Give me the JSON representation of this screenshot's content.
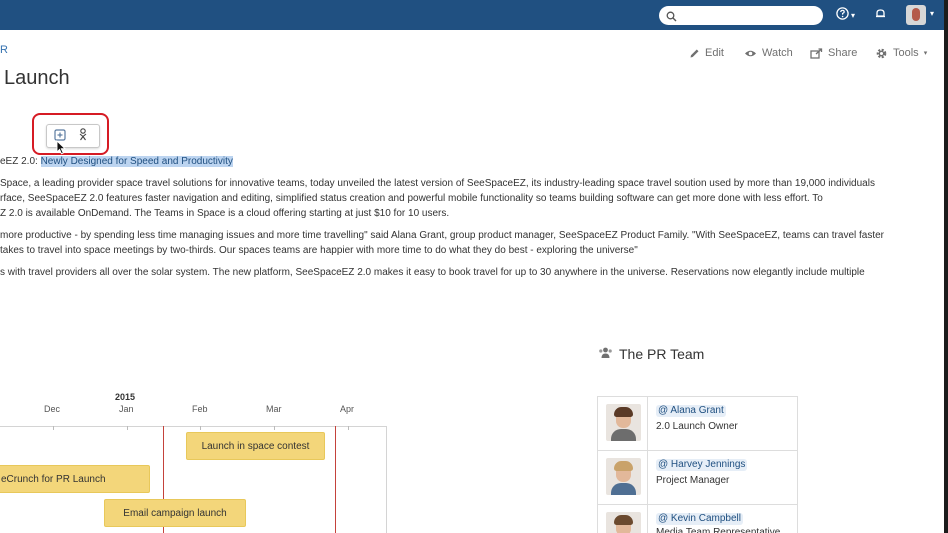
{
  "topbar": {
    "search_placeholder": "",
    "help_caret": "▾",
    "avatar_caret": "▾"
  },
  "breadcrumb": {
    "text": "R"
  },
  "page_actions": {
    "edit": "Edit",
    "watch": "Watch",
    "share": "Share",
    "tools": "Tools"
  },
  "page": {
    "title": "Launch"
  },
  "content": {
    "line1_prefix": "eEZ 2.0: ",
    "line1_highlight": "Newly Designed for Speed and Productivity",
    "para1": [
      "Space, a leading provider space travel solutions for innovative teams, today unveiled the latest version of SeeSpaceEZ, its industry-leading space travel soution used by more than 19,000 individuals",
      "rface, SeeSpaceEZ 2.0 features faster navigation and editing, simplified status creation and powerful mobile functionality so teams building software can get more done with less effort. To",
      "Z 2.0 is available OnDemand. The Teams in Space is a cloud offering starting at just $10 for 10 users."
    ],
    "para2": [
      "more productive - by spending less time managing issues and more time travelling\" said Alana Grant, group product manager, SeeSpaceEZ Product Family. \"With SeeSpaceEZ, teams can travel faster",
      "takes to travel into space meetings by two-thirds. Our spaces teams are happier with more time to do what they do best - exploring the universe\""
    ],
    "para3": [
      "s with travel providers all over the solar system.  The new platform, SeeSpaceEZ 2.0 makes it easy to book travel for up to 30 anywhere in the universe.  Reservations now elegantly include multiple"
    ]
  },
  "team": {
    "heading": "The PR Team",
    "members": [
      {
        "name": "@ Alana Grant",
        "role": "2.0 Launch Owner",
        "hair": "#5a3a26",
        "shirt": "#6d6d6d",
        "icon": "alana-photo"
      },
      {
        "name": "@ Harvey Jennings",
        "role": "Project Manager",
        "hair": "#c9a26a",
        "shirt": "#4f6f93",
        "icon": "harvey-photo"
      },
      {
        "name": "@ Kevin Campbell",
        "role": "Media Team Representative",
        "hair": "#6b4a2f",
        "shirt": "#3c3c3c",
        "icon": "kevin-photo"
      }
    ]
  },
  "timeline": {
    "year": "2015",
    "months": [
      "Dec",
      "Jan",
      "Feb",
      "Mar",
      "Apr"
    ],
    "bars": [
      {
        "label": "Launch in space contest"
      },
      {
        "label": "eCrunch for PR Launch"
      },
      {
        "label": "Email campaign launch"
      }
    ]
  },
  "colors": {
    "header_bg": "#205081",
    "link": "#3572b0",
    "highlight": "#bcd4f0",
    "bar": "#f3d67a",
    "marker_line": "#c4423b",
    "annotation": "#d61b24"
  }
}
